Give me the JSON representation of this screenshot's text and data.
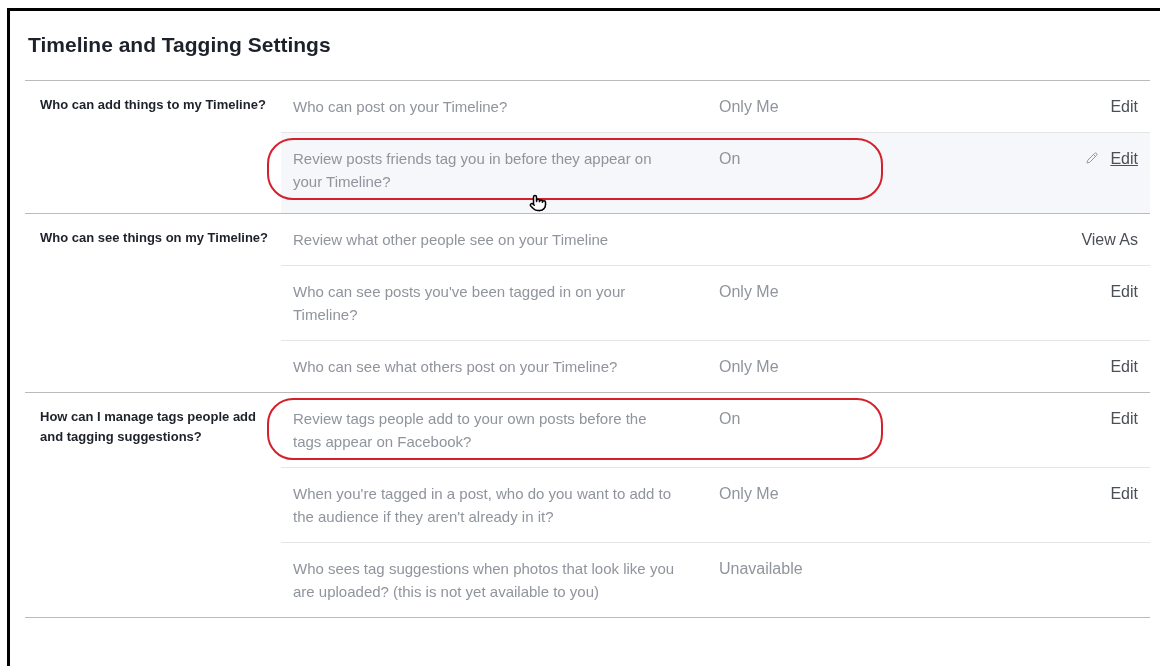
{
  "title": "Timeline and Tagging Settings",
  "sections": [
    {
      "label": "Who can add things to my Timeline?",
      "rows": [
        {
          "question": "Who can post on your Timeline?",
          "value": "Only Me",
          "action": "Edit",
          "hovered": false,
          "circled": false
        },
        {
          "question": "Review posts friends tag you in before they appear on your Timeline?",
          "value": "On",
          "action": "Edit",
          "hovered": true,
          "circled": true
        }
      ]
    },
    {
      "label": "Who can see things on my Timeline?",
      "rows": [
        {
          "question": "Review what other people see on your Timeline",
          "action": "View As",
          "hovered": false,
          "circled": false
        },
        {
          "question": "Who can see posts you've been tagged in on your Timeline?",
          "value": "Only Me",
          "action": "Edit",
          "hovered": false,
          "circled": false
        },
        {
          "question": "Who can see what others post on your Timeline?",
          "value": "Only Me",
          "action": "Edit",
          "hovered": false,
          "circled": false
        }
      ]
    },
    {
      "label": "How can I manage tags people add and tagging suggestions?",
      "rows": [
        {
          "question": "Review tags people add to your own posts before the tags appear on Facebook?",
          "value": "On",
          "action": "Edit",
          "hovered": false,
          "circled": true
        },
        {
          "question": "When you're tagged in a post, who do you want to add to the audience if they aren't already in it?",
          "value": "Only Me",
          "action": "Edit",
          "hovered": false,
          "circled": false
        },
        {
          "question": "Who sees tag suggestions when photos that look like you are uploaded? (this is not yet available to you)",
          "value": "Unavailable",
          "hovered": false,
          "circled": false
        }
      ]
    }
  ]
}
